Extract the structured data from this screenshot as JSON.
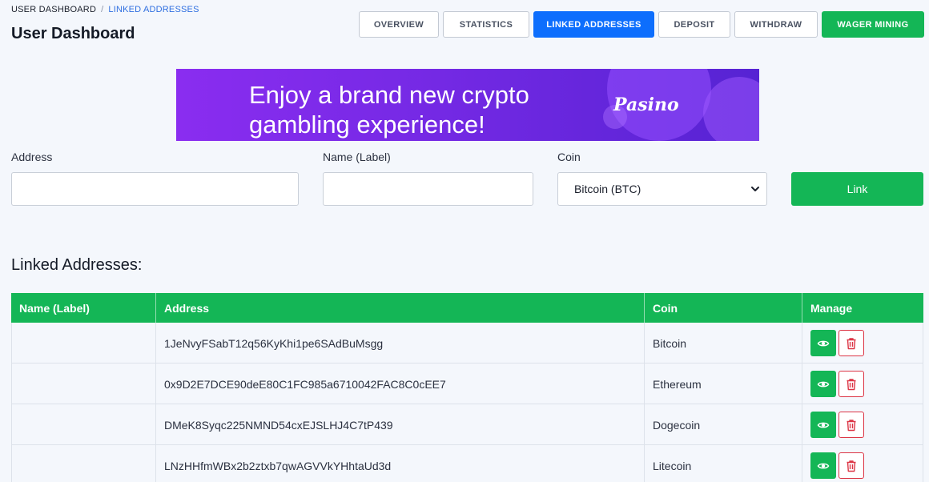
{
  "breadcrumb": {
    "home": "USER DASHBOARD",
    "separator": "/",
    "current": "LINKED ADDRESSES"
  },
  "page_title": "User Dashboard",
  "nav_tabs": [
    {
      "label": "OVERVIEW",
      "state": "default"
    },
    {
      "label": "STATISTICS",
      "state": "default"
    },
    {
      "label": "LINKED ADDRESSES",
      "state": "active"
    },
    {
      "label": "DEPOSIT",
      "state": "default"
    },
    {
      "label": "WITHDRAW",
      "state": "default"
    },
    {
      "label": "WAGER MINING",
      "state": "highlight"
    }
  ],
  "banner": {
    "text": "Enjoy a brand new crypto gambling experience!",
    "brand": "Pasino"
  },
  "form": {
    "address_label": "Address",
    "address_value": "",
    "name_label": "Name (Label)",
    "name_value": "",
    "coin_label": "Coin",
    "coin_selected": "Bitcoin (BTC)",
    "submit_label": "Link"
  },
  "section_title": "Linked Addresses:",
  "table": {
    "headers": [
      "Name (Label)",
      "Address",
      "Coin",
      "Manage"
    ],
    "rows": [
      {
        "name": "",
        "address": "1JeNvyFSabT12q56KyKhi1pe6SAdBuMsgg",
        "coin": "Bitcoin"
      },
      {
        "name": "",
        "address": "0x9D2E7DCE90deE80C1FC985a6710042FAC8C0cEE7",
        "coin": "Ethereum"
      },
      {
        "name": "",
        "address": "DMeK8Syqc225NMND54cxEJSLHJ4C7tP439",
        "coin": "Dogecoin"
      },
      {
        "name": "",
        "address": "LNzHHfmWBx2b2ztxb7qwAGVVkYHhtaUd3d",
        "coin": "Litecoin"
      }
    ]
  },
  "colors": {
    "primary": "#0d6efd",
    "success": "#14b656",
    "danger": "#dc3545",
    "background": "#f4f7fc"
  },
  "icons": {
    "view": "eye-icon",
    "delete": "trash-icon",
    "select": "chevron-down-icon"
  }
}
